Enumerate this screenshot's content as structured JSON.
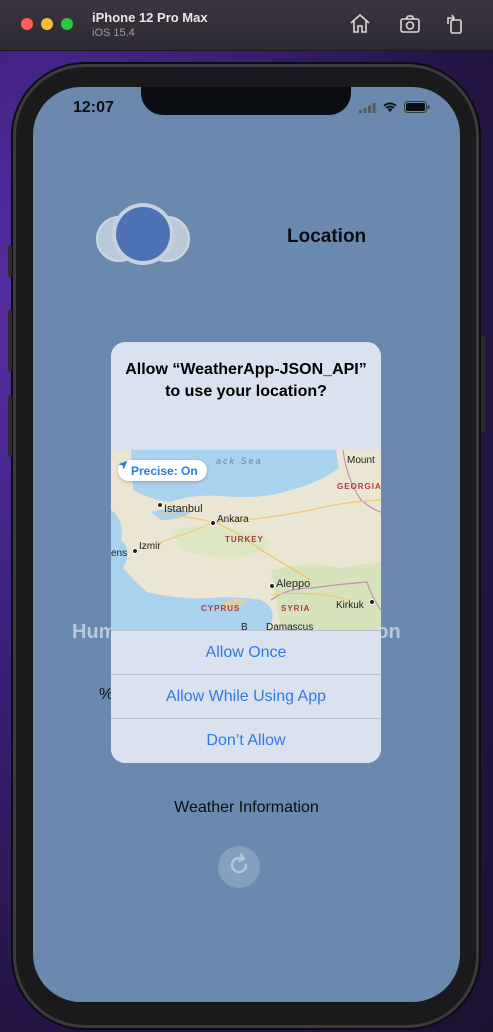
{
  "simulator": {
    "device": "iPhone 12 Pro Max",
    "os": "iOS 15.4",
    "icons": [
      "home-icon",
      "screenshot-icon",
      "rotate-icon"
    ]
  },
  "status_bar": {
    "time": "12:07"
  },
  "app": {
    "location_label": "Location",
    "humidity_label": "Hum",
    "description_label": "ation",
    "percent_label": "%",
    "weather_info": "Weather Information",
    "background_color": "#6e8db2",
    "cloud_color": "#4a72b8"
  },
  "alert": {
    "title": "Allow “WeatherApp-JSON_API” to use your location?",
    "precise_label": "Precise: On",
    "buttons": {
      "allow_once": "Allow Once",
      "allow_while_using": "Allow While Using App",
      "dont_allow": "Don’t Allow"
    },
    "accent_color": "#2f7ae5",
    "map_labels": {
      "sea": "ack Sea",
      "mount": "Mount",
      "georgia": "GEORGIA",
      "istanbul": "Istanbul",
      "ankara": "Ankara",
      "turkey": "TURKEY",
      "izmir": "Izmir",
      "athens": "ens",
      "aleppo": "Aleppo",
      "cyprus": "CYPRUS",
      "syria": "SYRIA",
      "kirkuk": "Kirkuk",
      "beirut": "B",
      "damascus": "Damascus"
    }
  }
}
